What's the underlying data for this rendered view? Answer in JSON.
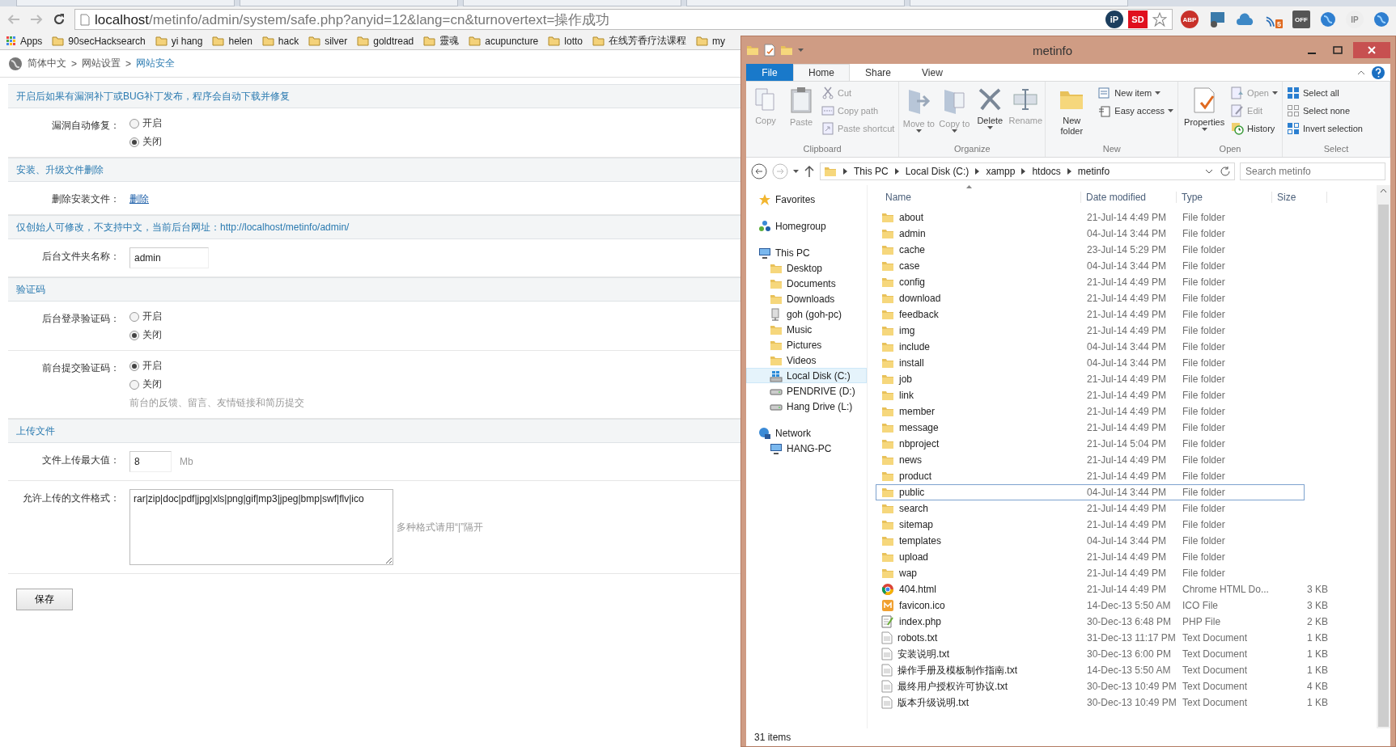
{
  "browser": {
    "url_host": "localhost",
    "url_path": "/metinfo/admin/system/safe.php?anyid=12&lang=cn&turnovertext=操作成功",
    "url_badges": [
      {
        "kind": "round",
        "label": "iP"
      },
      {
        "kind": "square",
        "label": "SD"
      }
    ],
    "extensions": [
      {
        "kind": "redround",
        "label": "ABP"
      },
      {
        "kind": "screen"
      },
      {
        "kind": "cloud"
      },
      {
        "kind": "signal",
        "label": "5"
      },
      {
        "kind": "darksquare",
        "label": "OFF"
      },
      {
        "kind": "globe"
      },
      {
        "kind": "lens",
        "label": "IP"
      },
      {
        "kind": "globe"
      }
    ],
    "bookmarks": [
      {
        "kind": "apps",
        "label": "Apps"
      },
      {
        "kind": "folder",
        "label": "90secHacksearch"
      },
      {
        "kind": "folder",
        "label": "yi hang"
      },
      {
        "kind": "folder",
        "label": "helen"
      },
      {
        "kind": "folder",
        "label": "hack"
      },
      {
        "kind": "folder",
        "label": "silver"
      },
      {
        "kind": "folder",
        "label": "goldtread"
      },
      {
        "kind": "folder",
        "label": "靈魂"
      },
      {
        "kind": "folder",
        "label": "acupuncture"
      },
      {
        "kind": "folder",
        "label": "lotto"
      },
      {
        "kind": "folder",
        "label": "在线芳香疗法课程"
      },
      {
        "kind": "folder",
        "label": "my"
      }
    ]
  },
  "page": {
    "breadcrumb": [
      {
        "label": "简体中文",
        "current": false
      },
      {
        "label": "网站设置",
        "current": false
      },
      {
        "label": "网站安全",
        "current": true
      }
    ],
    "separator": ">",
    "sections": [
      {
        "title": "开启后如果有漏洞补丁或BUG补丁发布，程序会自动下载并修复",
        "rows": [
          {
            "kind": "radio",
            "label": "漏洞自动修复：",
            "options": [
              {
                "label": "开启",
                "selected": false
              },
              {
                "label": "关闭",
                "selected": true
              }
            ]
          }
        ]
      },
      {
        "title": "安装、升级文件删除",
        "rows": [
          {
            "kind": "link",
            "label": "删除安装文件：",
            "link": "删除"
          }
        ]
      },
      {
        "title": "仅创始人可修改，不支持中文，当前后台网址：http://localhost/metinfo/admin/",
        "rows": [
          {
            "kind": "input",
            "label": "后台文件夹名称：",
            "value": "admin"
          }
        ]
      },
      {
        "title": "验证码",
        "rows": [
          {
            "kind": "radio",
            "label": "后台登录验证码：",
            "options": [
              {
                "label": "开启",
                "selected": false
              },
              {
                "label": "关闭",
                "selected": true
              }
            ]
          },
          {
            "kind": "radio",
            "label": "前台提交验证码：",
            "options": [
              {
                "label": "开启",
                "selected": true
              },
              {
                "label": "关闭",
                "selected": false
              }
            ],
            "hint": "前台的反馈、留言、友情链接和简历提交"
          }
        ]
      },
      {
        "title": "上传文件",
        "rows": [
          {
            "kind": "input",
            "label": "文件上传最大值：",
            "value": "8",
            "unit": "Mb"
          },
          {
            "kind": "textarea",
            "label": "允许上传的文件格式：",
            "value": "rar|zip|doc|pdf|jpg|xls|png|gif|mp3|jpeg|bmp|swf|flv|ico",
            "hint": "多种格式请用“|”隔开"
          }
        ]
      }
    ],
    "save_button": "保存"
  },
  "explorer": {
    "title": "metinfo",
    "ribbon_tabs": [
      {
        "label": "File",
        "kind": "backstage",
        "selected": false
      },
      {
        "label": "Home",
        "kind": "tab",
        "selected": true
      },
      {
        "label": "Share",
        "kind": "tab",
        "selected": false
      },
      {
        "label": "View",
        "kind": "tab",
        "selected": false
      }
    ],
    "groups": [
      {
        "name": "Clipboard",
        "commands": [
          {
            "label": "Copy",
            "kind": "large",
            "disabled": true
          },
          {
            "label": "Paste",
            "kind": "large",
            "disabled": true
          },
          {
            "label": "Cut",
            "kind": "small",
            "disabled": true
          },
          {
            "label": "Copy path",
            "kind": "small",
            "disabled": true
          },
          {
            "label": "Paste shortcut",
            "kind": "small",
            "disabled": true
          }
        ]
      },
      {
        "name": "Organize",
        "commands": [
          {
            "label": "Move to",
            "kind": "large",
            "disabled": true,
            "dropdown": true
          },
          {
            "label": "Copy to",
            "kind": "large",
            "disabled": true,
            "dropdown": true
          },
          {
            "label": "Delete",
            "kind": "large",
            "disabled": false,
            "dropdown": true
          },
          {
            "label": "Rename",
            "kind": "large",
            "disabled": true
          }
        ]
      },
      {
        "name": "New",
        "commands": [
          {
            "label": "New folder",
            "kind": "large",
            "disabled": false
          },
          {
            "label": "New item",
            "kind": "small",
            "disabled": false,
            "dropdown": true
          },
          {
            "label": "Easy access",
            "kind": "small",
            "disabled": false,
            "dropdown": true
          }
        ]
      },
      {
        "name": "Open",
        "commands": [
          {
            "label": "Properties",
            "kind": "large",
            "disabled": false,
            "dropdown": true
          },
          {
            "label": "Open",
            "kind": "small",
            "disabled": true,
            "dropdown": true
          },
          {
            "label": "Edit",
            "kind": "small",
            "disabled": true
          },
          {
            "label": "History",
            "kind": "small",
            "disabled": false
          }
        ]
      },
      {
        "name": "Select",
        "commands": [
          {
            "label": "Select all",
            "kind": "small",
            "disabled": false
          },
          {
            "label": "Select none",
            "kind": "small",
            "disabled": false
          },
          {
            "label": "Invert selection",
            "kind": "small",
            "disabled": false
          }
        ]
      }
    ],
    "path": [
      "This PC",
      "Local Disk (C:)",
      "xampp",
      "htdocs",
      "metinfo"
    ],
    "search": {
      "placeholder": "Search metinfo"
    },
    "nav": [
      {
        "label": "Favorites",
        "kind": "star",
        "selected": false
      },
      {
        "label": "Homegroup",
        "kind": "homegroup",
        "selected": false
      },
      {
        "label": "This PC",
        "kind": "pc",
        "selected": false,
        "children": [
          {
            "label": "Desktop",
            "kind": "folder",
            "selected": false
          },
          {
            "label": "Documents",
            "kind": "folder",
            "selected": false
          },
          {
            "label": "Downloads",
            "kind": "folder",
            "selected": false
          },
          {
            "label": "goh (goh-pc)",
            "kind": "share",
            "selected": false
          },
          {
            "label": "Music",
            "kind": "folder",
            "selected": false
          },
          {
            "label": "Pictures",
            "kind": "folder",
            "selected": false
          },
          {
            "label": "Videos",
            "kind": "folder",
            "selected": false
          },
          {
            "label": "Local Disk (C:)",
            "kind": "disk",
            "selected": true
          },
          {
            "label": "PENDRIVE (D:)",
            "kind": "drive",
            "selected": false
          },
          {
            "label": "Hang Drive (L:)",
            "kind": "drive",
            "selected": false
          }
        ]
      },
      {
        "label": "Network",
        "kind": "network",
        "selected": false,
        "children": [
          {
            "label": "HANG-PC",
            "kind": "pc",
            "selected": false
          }
        ]
      }
    ],
    "columns": [
      "Name",
      "Date modified",
      "Type",
      "Size"
    ],
    "files": [
      {
        "name": "about",
        "date": "21-Jul-14 4:49 PM",
        "type": "File folder",
        "kind": "folder",
        "selected": false
      },
      {
        "name": "admin",
        "date": "04-Jul-14 3:44 PM",
        "type": "File folder",
        "kind": "folder",
        "selected": false
      },
      {
        "name": "cache",
        "date": "23-Jul-14 5:29 PM",
        "type": "File folder",
        "kind": "folder",
        "selected": false
      },
      {
        "name": "case",
        "date": "04-Jul-14 3:44 PM",
        "type": "File folder",
        "kind": "folder",
        "selected": false
      },
      {
        "name": "config",
        "date": "21-Jul-14 4:49 PM",
        "type": "File folder",
        "kind": "folder",
        "selected": false
      },
      {
        "name": "download",
        "date": "21-Jul-14 4:49 PM",
        "type": "File folder",
        "kind": "folder",
        "selected": false
      },
      {
        "name": "feedback",
        "date": "21-Jul-14 4:49 PM",
        "type": "File folder",
        "kind": "folder",
        "selected": false
      },
      {
        "name": "img",
        "date": "21-Jul-14 4:49 PM",
        "type": "File folder",
        "kind": "folder",
        "selected": false
      },
      {
        "name": "include",
        "date": "04-Jul-14 3:44 PM",
        "type": "File folder",
        "kind": "folder",
        "selected": false
      },
      {
        "name": "install",
        "date": "04-Jul-14 3:44 PM",
        "type": "File folder",
        "kind": "folder",
        "selected": false
      },
      {
        "name": "job",
        "date": "21-Jul-14 4:49 PM",
        "type": "File folder",
        "kind": "folder",
        "selected": false
      },
      {
        "name": "link",
        "date": "21-Jul-14 4:49 PM",
        "type": "File folder",
        "kind": "folder",
        "selected": false
      },
      {
        "name": "member",
        "date": "21-Jul-14 4:49 PM",
        "type": "File folder",
        "kind": "folder",
        "selected": false
      },
      {
        "name": "message",
        "date": "21-Jul-14 4:49 PM",
        "type": "File folder",
        "kind": "folder",
        "selected": false
      },
      {
        "name": "nbproject",
        "date": "21-Jul-14 5:04 PM",
        "type": "File folder",
        "kind": "folder",
        "selected": false
      },
      {
        "name": "news",
        "date": "21-Jul-14 4:49 PM",
        "type": "File folder",
        "kind": "folder",
        "selected": false
      },
      {
        "name": "product",
        "date": "21-Jul-14 4:49 PM",
        "type": "File folder",
        "kind": "folder",
        "selected": false
      },
      {
        "name": "public",
        "date": "04-Jul-14 3:44 PM",
        "type": "File folder",
        "kind": "folder",
        "selected": true
      },
      {
        "name": "search",
        "date": "21-Jul-14 4:49 PM",
        "type": "File folder",
        "kind": "folder",
        "selected": false
      },
      {
        "name": "sitemap",
        "date": "21-Jul-14 4:49 PM",
        "type": "File folder",
        "kind": "folder",
        "selected": false
      },
      {
        "name": "templates",
        "date": "04-Jul-14 3:44 PM",
        "type": "File folder",
        "kind": "folder",
        "selected": false
      },
      {
        "name": "upload",
        "date": "21-Jul-14 4:49 PM",
        "type": "File folder",
        "kind": "folder",
        "selected": false
      },
      {
        "name": "wap",
        "date": "21-Jul-14 4:49 PM",
        "type": "File folder",
        "kind": "folder",
        "selected": false
      },
      {
        "name": "404.html",
        "date": "21-Jul-14 4:49 PM",
        "type": "Chrome HTML Do...",
        "size": "3 KB",
        "kind": "chrome",
        "selected": false
      },
      {
        "name": "favicon.ico",
        "date": "14-Dec-13 5:50 AM",
        "type": "ICO File",
        "size": "3 KB",
        "kind": "ico",
        "selected": false
      },
      {
        "name": "index.php",
        "date": "30-Dec-13 6:48 PM",
        "type": "PHP File",
        "size": "2 KB",
        "kind": "php",
        "selected": false
      },
      {
        "name": "robots.txt",
        "date": "31-Dec-13 11:17 PM",
        "type": "Text Document",
        "size": "1 KB",
        "kind": "text",
        "selected": false
      },
      {
        "name": "安装说明.txt",
        "date": "30-Dec-13 6:00 PM",
        "type": "Text Document",
        "size": "1 KB",
        "kind": "text",
        "selected": false
      },
      {
        "name": "操作手册及模板制作指南.txt",
        "date": "14-Dec-13 5:50 AM",
        "type": "Text Document",
        "size": "1 KB",
        "kind": "text",
        "selected": false
      },
      {
        "name": "最终用户授权许可协议.txt",
        "date": "30-Dec-13 10:49 PM",
        "type": "Text Document",
        "size": "4 KB",
        "kind": "text",
        "selected": false
      },
      {
        "name": "版本升级说明.txt",
        "date": "30-Dec-13 10:49 PM",
        "type": "Text Document",
        "size": "1 KB",
        "kind": "text",
        "selected": false
      }
    ],
    "status": "31 items"
  }
}
